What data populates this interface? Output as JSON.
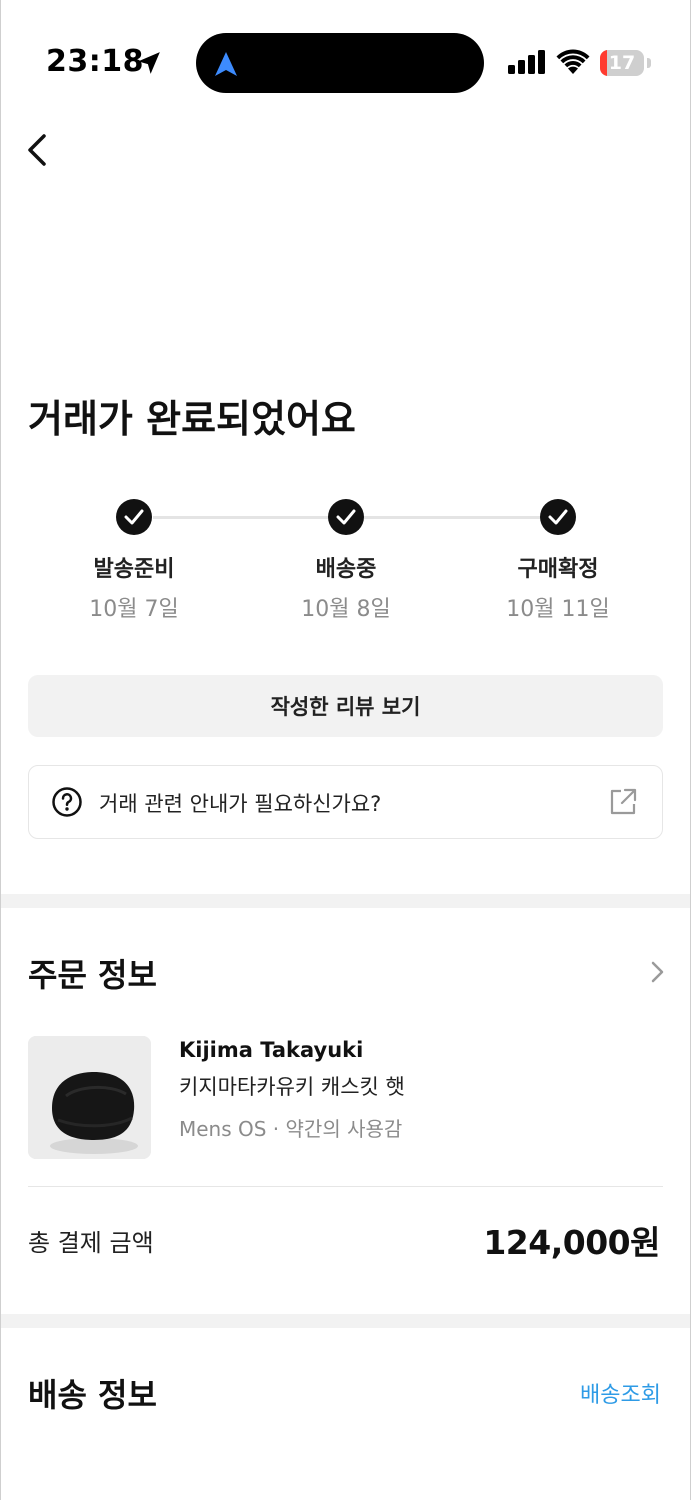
{
  "status_bar": {
    "time": "23:18",
    "battery_level": "17",
    "battery_fraction": 0.17,
    "battery_color": "#ff3b30",
    "icons": [
      "location-arrow-icon",
      "navigation-icon",
      "cellular-signal-icon",
      "wifi-icon",
      "battery-icon"
    ]
  },
  "header": {
    "back_icon": "chevron-left-icon"
  },
  "main": {
    "title": "거래가 완료되었어요",
    "steps": [
      {
        "label": "발송준비",
        "date": "10월 7일",
        "done": true
      },
      {
        "label": "배송중",
        "date": "10월 8일",
        "done": true
      },
      {
        "label": "구매확정",
        "date": "10월 11일",
        "done": true
      }
    ],
    "review_button": "작성한 리뷰 보기",
    "guide": {
      "text": "거래 관련 안내가 필요하신가요?",
      "icon": "question-circle-icon",
      "external_icon": "external-link-icon"
    }
  },
  "order_info": {
    "title": "주문 정보",
    "product": {
      "brand": "Kijima Takayuki",
      "name": "키지마타카유키 캐스킷 햇",
      "meta": "Mens OS · 약간의 사용감"
    },
    "total_label": "총 결제 금액",
    "total_value": "124,000원"
  },
  "shipping_info": {
    "title": "배송 정보",
    "track_link": "배송조회"
  },
  "colors": {
    "accent": "#2e9be6",
    "step_done": "#111111",
    "divider": "#f2f2f2"
  }
}
